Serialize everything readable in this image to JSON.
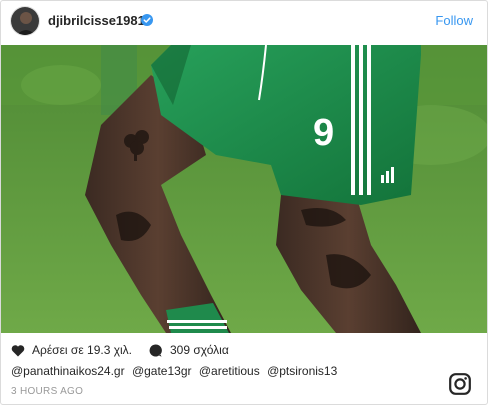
{
  "post": {
    "username": "djibrilcisse1981",
    "follow_label": "Follow",
    "likes_label": "Αρέσει σε 19.3 χιλ.",
    "comments_label": "309 σχόλια",
    "mentions": [
      "@panathinaikos24.gr",
      "@gate13gr",
      "@aretitious",
      "@ptsironis13"
    ],
    "time_ago": "3 HOURS AGO",
    "jersey_number": "9"
  },
  "colors": {
    "accent": "#3897f0",
    "grass": "#5e9b3c",
    "kit_green": "#1f8a4c"
  },
  "icons": {
    "verified": "verified-badge-icon",
    "like": "heart-icon",
    "comment": "comment-bubble-icon",
    "brand": "instagram-icon"
  }
}
